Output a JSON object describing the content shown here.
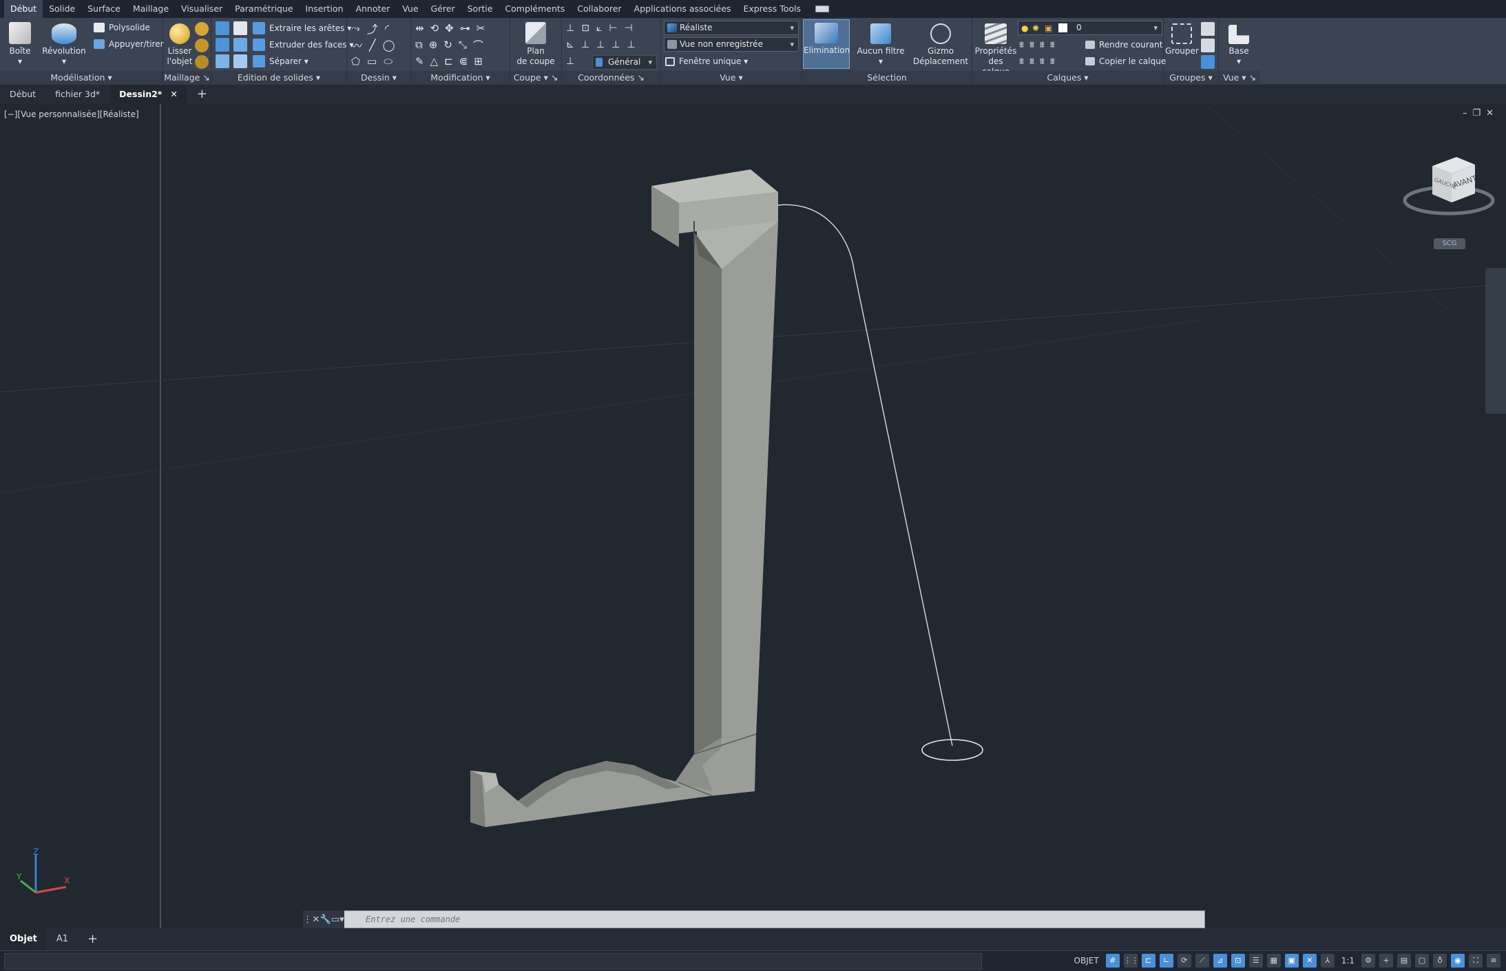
{
  "ribbon_tabs": [
    "Début",
    "Solide",
    "Surface",
    "Maillage",
    "Visualiser",
    "Paramétrique",
    "Insertion",
    "Annoter",
    "Vue",
    "Gérer",
    "Sortie",
    "Compléments",
    "Collaborer",
    "Applications associées",
    "Express Tools"
  ],
  "active_tab": "Début",
  "panels": {
    "modelisation": {
      "label": "Modélisation ▾",
      "boite": "Boîte",
      "revolution": "Révolution",
      "polysolide": "Polysolide",
      "appuyer": "Appuyer/tirer"
    },
    "maillage": {
      "label": "Maillage ↘",
      "lisser_l1": "Lisser",
      "lisser_l2": "l'objet"
    },
    "edition": {
      "label": "Edition de solides ▾",
      "extraire": "Extraire les arêtes ▾",
      "extruder": "Extruder des faces ▾",
      "separer": "Séparer ▾"
    },
    "dessin": {
      "label": "Dessin ▾"
    },
    "modification": {
      "label": "Modification ▾"
    },
    "coupe": {
      "label": "Coupe ▾ ↘",
      "plan_l1": "Plan",
      "plan_l2": "de coupe"
    },
    "coordonnees": {
      "label": "Coordonnées ↘",
      "general": "Général"
    },
    "vue": {
      "label": "Vue ▾",
      "style": "Réaliste",
      "view": "Vue non enregistrée",
      "fenetre": "Fenêtre unique ▾"
    },
    "selection": {
      "label": "Sélection",
      "elimination": "Elimination",
      "aucun_filtre": "Aucun filtre",
      "gizmo_l1": "Gizmo",
      "gizmo_l2": "Déplacement"
    },
    "calques": {
      "label": "Calques ▾",
      "proprietes_l1": "Propriétés",
      "proprietes_l2": "des calque",
      "layer_value": "0",
      "rendre_courant": "Rendre courant",
      "copier_calque": "Copier le calque"
    },
    "groupes": {
      "label": "Groupes ▾",
      "grouper": "Grouper"
    },
    "vue2": {
      "label": "Vue ▾ ↘",
      "base": "Base"
    }
  },
  "doc_tabs": [
    {
      "label": "Début",
      "active": false,
      "close": false
    },
    {
      "label": "fichier 3d*",
      "active": false,
      "close": false
    },
    {
      "label": "Dessin2*",
      "active": true,
      "close": true
    }
  ],
  "viewport": {
    "label": "[−][Vue personnalisée][Réaliste]",
    "viewcube_face": "AVANT",
    "viewcube_side": "GAUCHE",
    "ucs_badge": "SCG",
    "axis_x": "X",
    "axis_y": "Y",
    "axis_z": "Z"
  },
  "command": {
    "placeholder": "Entrez une commande"
  },
  "layout_tabs": [
    {
      "label": "Objet",
      "active": true
    },
    {
      "label": "A1",
      "active": false
    }
  ],
  "status": {
    "model_label": "OBJET",
    "scale": "1:1"
  },
  "colors": {
    "ribbon_bg": "#3b4453",
    "viewport_bg": "#212830",
    "solid_front": "#9a9c98",
    "solid_side": "#737572",
    "solid_top": "#b9bbb7",
    "accent": "#4a90d9"
  }
}
